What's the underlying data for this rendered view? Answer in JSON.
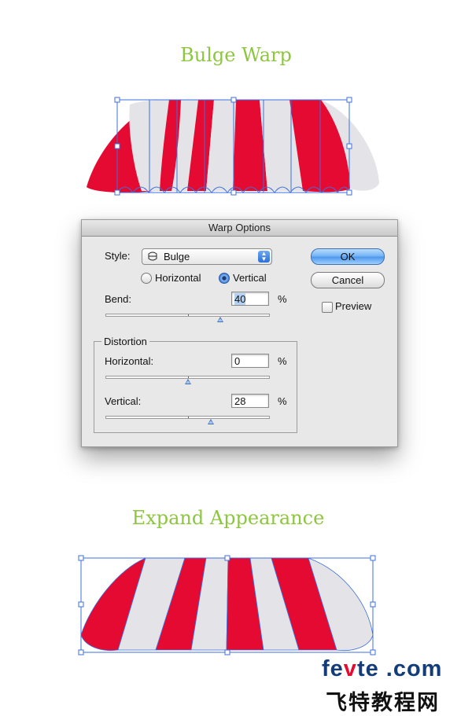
{
  "headings": {
    "top": "Bulge Warp",
    "bottom": "Expand Appearance"
  },
  "colors": {
    "heading": "#8dc63f",
    "stripe_red": "#e40a31",
    "stripe_gray": "#e4e4e8",
    "selection": "#3d6fdc"
  },
  "dialog": {
    "title": "Warp Options",
    "style_label": "Style:",
    "style_value": "Bulge",
    "style_icon": "bulge-icon",
    "orientation": {
      "horizontal_label": "Horizontal",
      "vertical_label": "Vertical",
      "selected": "Vertical"
    },
    "bend": {
      "label": "Bend:",
      "value": "40",
      "unit": "%",
      "percent": 40
    },
    "distortion": {
      "group_label": "Distortion",
      "horizontal": {
        "label": "Horizontal:",
        "value": "0",
        "unit": "%",
        "percent": 0
      },
      "vertical": {
        "label": "Vertical:",
        "value": "28",
        "unit": "%",
        "percent": 28
      }
    },
    "ok_label": "OK",
    "cancel_label": "Cancel",
    "preview": {
      "label": "Preview",
      "checked": false
    }
  },
  "watermark": {
    "fe": "fe",
    "v": "v",
    "te_com": "te .com",
    "chinese": "飞特教程网"
  }
}
